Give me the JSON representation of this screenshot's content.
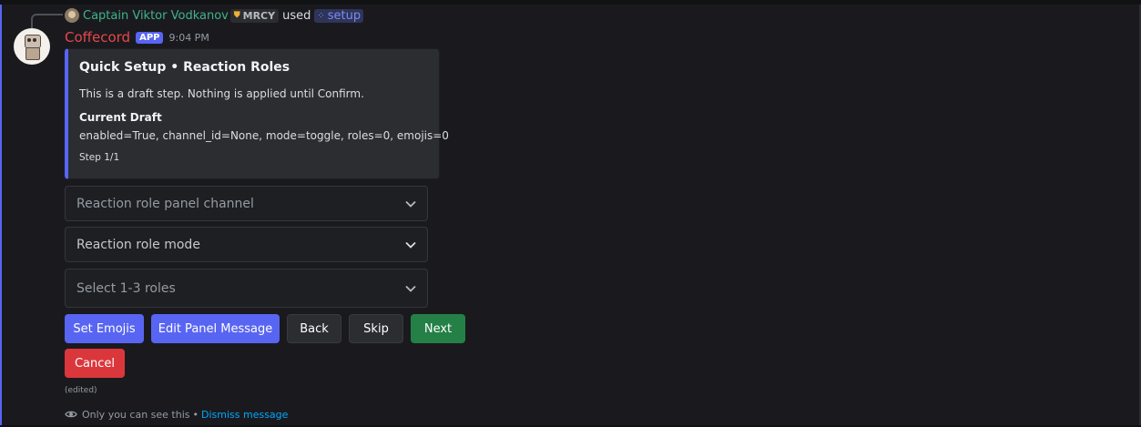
{
  "colors": {
    "accent": "#5865f2",
    "success": "#248046",
    "danger": "#da373c",
    "username": "#e7474b",
    "reply_username": "#3fb389",
    "link": "#00a8fc",
    "background": "#1a1a1e"
  },
  "reply": {
    "avatar_icon": "user-avatar-icon",
    "username": "Captain Viktor Vodkanov",
    "tag_icon": "shield-icon",
    "tag": "MRCY",
    "used_text": "used",
    "command_icon": "slash-command-icon",
    "command": "setup"
  },
  "message": {
    "author": "Coffecord",
    "badge": "APP",
    "timestamp": "9:04 PM",
    "avatar_icon": "robot-avatar-icon"
  },
  "embed": {
    "title": "Quick Setup • Reaction Roles",
    "description": "This is a draft step. Nothing is applied until Confirm.",
    "field_name": "Current Draft",
    "field_value": "enabled=True, channel_id=None, mode=toggle, roles=0, emojis=0",
    "footer": "Step 1/1"
  },
  "selects": [
    {
      "placeholder": "Reaction role panel channel"
    },
    {
      "placeholder": "Reaction role mode"
    },
    {
      "placeholder": "Select 1-3 roles"
    }
  ],
  "buttons": {
    "set_emojis": "Set Emojis",
    "edit_panel_message": "Edit Panel Message",
    "back": "Back",
    "skip": "Skip",
    "next": "Next",
    "cancel": "Cancel"
  },
  "edited_label": "(edited)",
  "ephemeral": {
    "icon": "eye-icon",
    "text": "Only you can see this",
    "separator": "•",
    "dismiss": "Dismiss message"
  }
}
